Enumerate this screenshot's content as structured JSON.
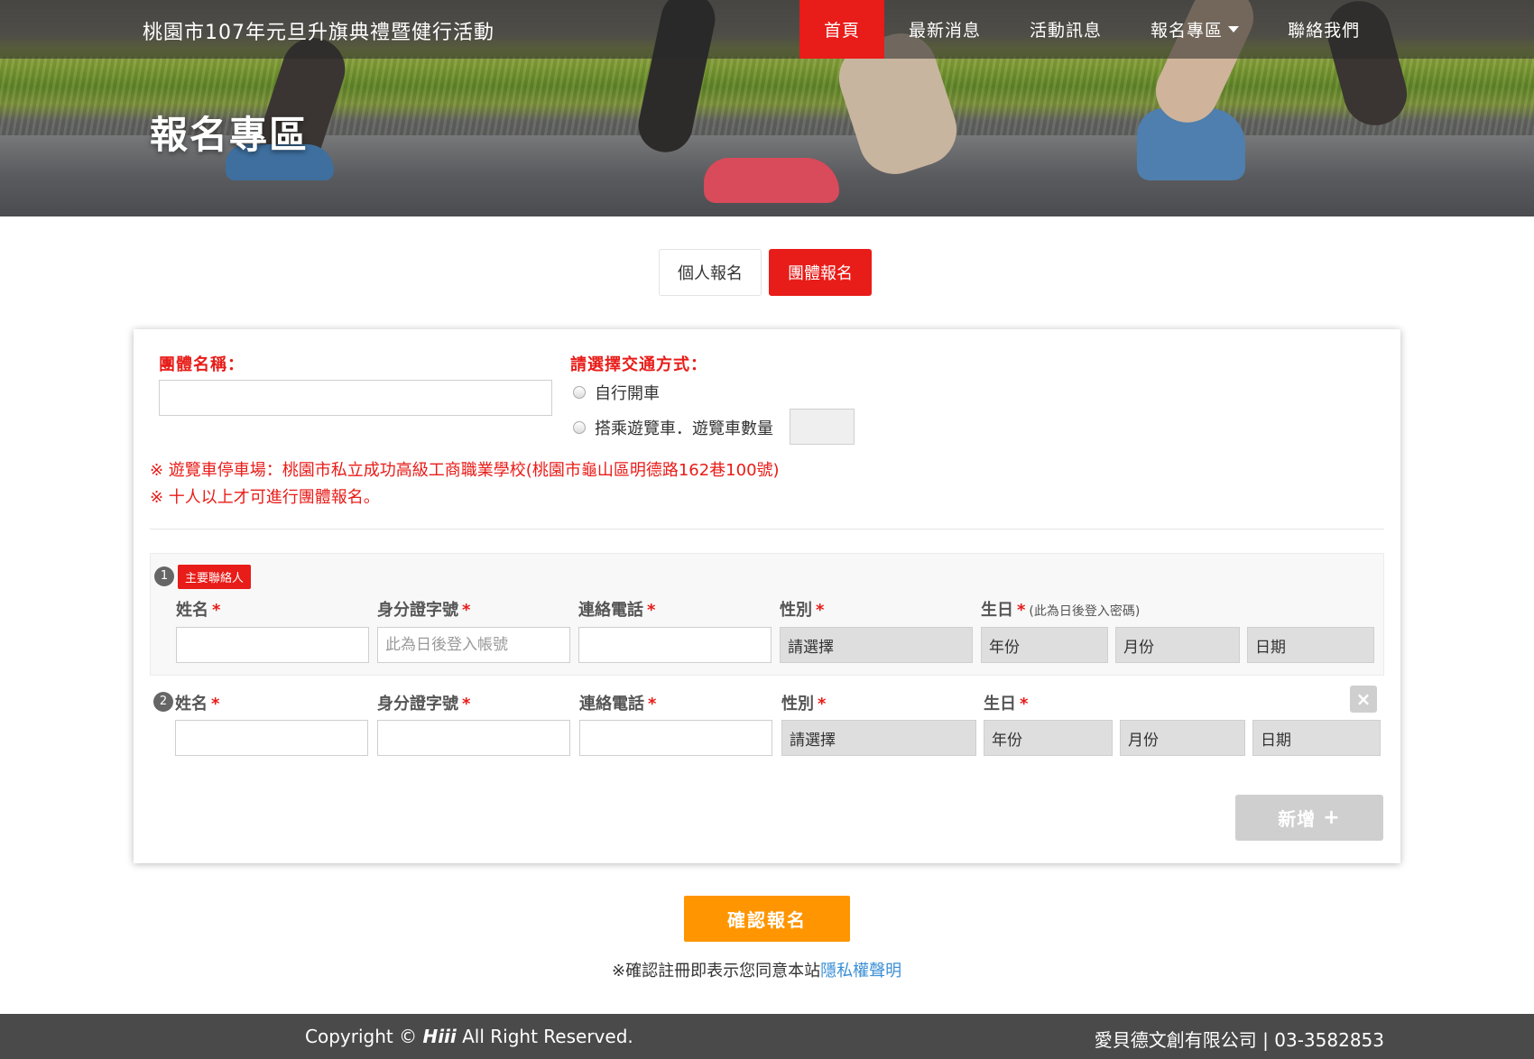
{
  "header": {
    "site_title": "桃園市107年元旦升旗典禮暨健行活動",
    "nav": [
      "首頁",
      "最新消息",
      "活動訊息",
      "報名專區",
      "聯絡我們"
    ],
    "hero_heading": "報名專區"
  },
  "tabs": [
    "個人報名",
    "團體報名"
  ],
  "form": {
    "group_name_label": "團體名稱：",
    "transport_label": "請選擇交通方式：",
    "option_self_drive": "自行開車",
    "option_bus": "搭乘遊覽車．遊覽車數量",
    "note_parking": "※ 遊覽車停車場：桃園市私立成功高級工商職業學校(桃園市龜山區明德路162巷100號)",
    "note_min_people": "※ 十人以上才可進行團體報名。",
    "primary_badge": "主要聯絡人",
    "columns": {
      "name": "姓名",
      "id": "身分證字號",
      "phone": "連絡電話",
      "gender": "性別",
      "birthday": "生日",
      "required_mark": "*",
      "birthday_hint": "(此為日後登入密碼)"
    },
    "id_placeholder": "此為日後登入帳號",
    "select_gender": "請選擇",
    "select_year": "年份",
    "select_month": "月份",
    "select_day": "日期",
    "row_numbers": [
      "1",
      "2"
    ],
    "delete_icon": "×",
    "add_label": "新增",
    "add_icon": "+"
  },
  "confirm_label": "確認報名",
  "agree_text": "※確認註冊即表示您同意本站",
  "privacy_link": "隱私權聲明",
  "footer": {
    "copyright_prefix": "Copyright ©",
    "brand": "Hiii",
    "copyright_suffix": "All Right Reserved.",
    "company": "愛貝德文創有限公司 | 03-3582853"
  },
  "colors": {
    "accent": "#e81c18",
    "confirm": "#ff9500",
    "link": "#3b8fd5",
    "footer": "#4a4a4a"
  }
}
